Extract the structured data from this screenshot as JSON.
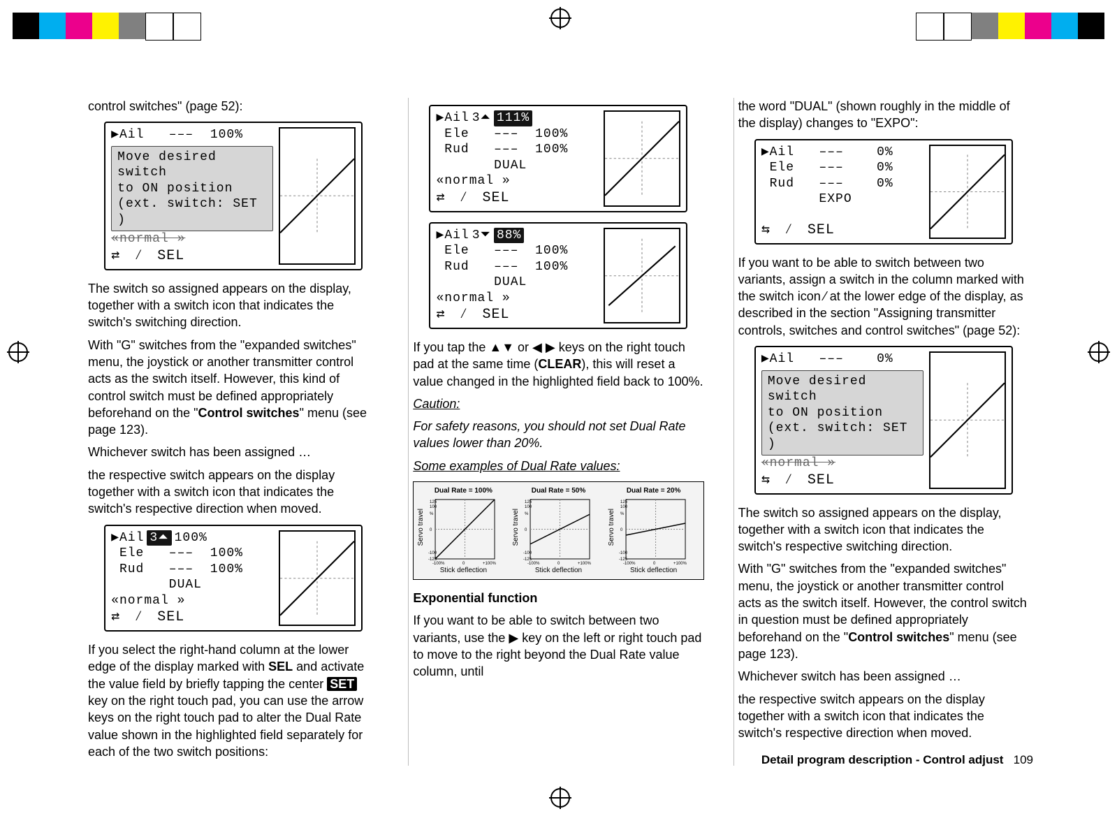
{
  "swatches_left": [
    "#000000",
    "#00aeef",
    "#ec008c",
    "#fff200",
    "#808080",
    "#ffffff",
    "#ffffff"
  ],
  "swatches_right": [
    "#ffffff",
    "#ffffff",
    "#808080",
    "#fff200",
    "#ec008c",
    "#00aeef",
    "#000000"
  ],
  "col1": {
    "p1": "control switches\" (page 52):",
    "lcd1": {
      "ail": "▶Ail   –––  100%",
      "hint1": "Move desired switch",
      "hint2": "to ON position",
      "hint3": "(ext. switch: SET   )",
      "sel": "SEL",
      "normal": "«normal »"
    },
    "p2": "The switch so assigned appears on the display, together with a switch icon that indicates the switch's switching direction.",
    "p3": "With \"G\" switches from the \"expanded switches\" menu, the joystick or another transmitter control acts as the switch itself. However, this kind of control switch must be defined appropriately beforehand on the \"",
    "p3b": "Control switches",
    "p3c": "\" menu (see page 123).",
    "p4": "Whichever switch has been assigned …",
    "p5": "the respective switch appears on the display together with a switch icon that indicates the switch's respective direction when moved.",
    "lcd2": {
      "r1a": "▶Ail",
      "r1b": "3⏶",
      "r1c": "100%",
      "r2": " Ele   –––  100%",
      "r3": " Rud   –––  100%",
      "r4": "       DUAL",
      "r5": "«normal »",
      "sel": "SEL"
    },
    "p6a": "If you select the right-hand column at the lower edge of the display marked with ",
    "p6sel": "SEL",
    "p6b": " and activate the value field by briefly tapping the center ",
    "p6set": "SET",
    "p6c": " key on the right touch pad, you can use the arrow keys on the right touch pad to alter the Dual Rate value shown in the highlighted field separately for each of the two switch positions:"
  },
  "col2": {
    "lcdA": {
      "r1a": "▶Ail",
      "r1b": "3⏶",
      "r1c": "111%",
      "r2": " Ele   –––  100%",
      "r3": " Rud   –––  100%",
      "r4": "       DUAL",
      "r5": "«normal »",
      "sel": "SEL"
    },
    "lcdB": {
      "r1a": "▶Ail",
      "r1b": "3⏷",
      "r1c": "88%",
      "r2": " Ele   –––  100%",
      "r3": " Rud   –––  100%",
      "r4": "       DUAL",
      "r5": "«normal »",
      "sel": "SEL"
    },
    "p1a": "If you tap the ▲▼ or ◀ ▶ keys on the right touch pad at the same time (",
    "p1clear": "CLEAR",
    "p1b": "), this will reset a value changed in the highlighted field back to 100%.",
    "cautionHead": "Caution:",
    "caution": "For safety reasons, you should not set Dual Rate values lower than 20%.",
    "examplesHead": "Some examples of Dual Rate values:",
    "ex": [
      {
        "title": "Dual Rate = 100%",
        "ylabel": "Servo travel",
        "xlabel": "Stick deflection",
        "ticks": [
          "125",
          "100",
          "%",
          "0",
          "-100",
          "-125"
        ],
        "xt": [
          "-100%",
          "0",
          "+100%"
        ]
      },
      {
        "title": "Dual Rate = 50%",
        "ylabel": "Servo travel",
        "xlabel": "Stick deflection",
        "ticks": [
          "125",
          "100",
          "%",
          "0",
          "-100",
          "-125"
        ],
        "xt": [
          "-100%",
          "0",
          "+100%"
        ]
      },
      {
        "title": "Dual Rate = 20%",
        "ylabel": "Servo travel",
        "xlabel": "Stick deflection",
        "ticks": [
          "125",
          "100",
          "%",
          "0",
          "-100",
          "-125"
        ],
        "xt": [
          "-100%",
          "0",
          "+100%"
        ]
      }
    ],
    "expHead": "Exponential function",
    "p2": "If you want to be able to switch between two variants, use the ▶ key on the left or right touch pad to move to the right beyond the Dual Rate value column, until"
  },
  "col3": {
    "p1": "the word \"DUAL\" (shown roughly in the middle of the display) changes to \"EXPO\":",
    "lcd": {
      "r1": "▶Ail   –––    0%",
      "r2": " Ele   –––    0%",
      "r3": " Rud   –––    0%",
      "r4": "       EXPO",
      "sel": "SEL"
    },
    "p2a": "If you want to be able to switch between two variants, assign a switch in the column marked with the switch icon ",
    "p2b": " at the lower edge of the display, as described in the section \"Assigning transmitter controls, switches and control switches\" (page 52):",
    "lcd2": {
      "ail": "▶Ail   –––    0%",
      "hint1": "Move desired switch",
      "hint2": "to ON position",
      "hint3": "(ext. switch: SET   )",
      "sel": "SEL",
      "normal": "«normal »"
    },
    "p3": "The switch so assigned appears on the display, together with a switch icon that indicates the switch's respective switching direction.",
    "p4a": "With \"G\" switches from the \"expanded switches\" menu, the joystick or another transmitter control acts as the switch itself. However, the control switch in question must be defined appropriately beforehand on the \"",
    "p4b": "Control switches",
    "p4c": "\" menu (see page 123).",
    "p5": "Whichever switch has been assigned …",
    "p6": " the respective switch appears on the display together with a switch icon that indicates the switch's respective direction when moved."
  },
  "footer": {
    "label": "Detail program description - Control adjust",
    "page": "109"
  },
  "chart_data": [
    {
      "type": "line",
      "title": "Dual Rate = 100%",
      "xlabel": "Stick deflection",
      "ylabel": "Servo travel",
      "xlim": [
        -100,
        100
      ],
      "ylim": [
        -125,
        125
      ],
      "series": [
        {
          "name": "servo",
          "x": [
            -100,
            0,
            100
          ],
          "y": [
            -100,
            0,
            100
          ]
        }
      ]
    },
    {
      "type": "line",
      "title": "Dual Rate = 50%",
      "xlabel": "Stick deflection",
      "ylabel": "Servo travel",
      "xlim": [
        -100,
        100
      ],
      "ylim": [
        -125,
        125
      ],
      "series": [
        {
          "name": "servo",
          "x": [
            -100,
            0,
            100
          ],
          "y": [
            -50,
            0,
            50
          ]
        }
      ]
    },
    {
      "type": "line",
      "title": "Dual Rate = 20%",
      "xlabel": "Stick deflection",
      "ylabel": "Servo travel",
      "xlim": [
        -100,
        100
      ],
      "ylim": [
        -125,
        125
      ],
      "series": [
        {
          "name": "servo",
          "x": [
            -100,
            0,
            100
          ],
          "y": [
            -20,
            0,
            20
          ]
        }
      ]
    }
  ]
}
